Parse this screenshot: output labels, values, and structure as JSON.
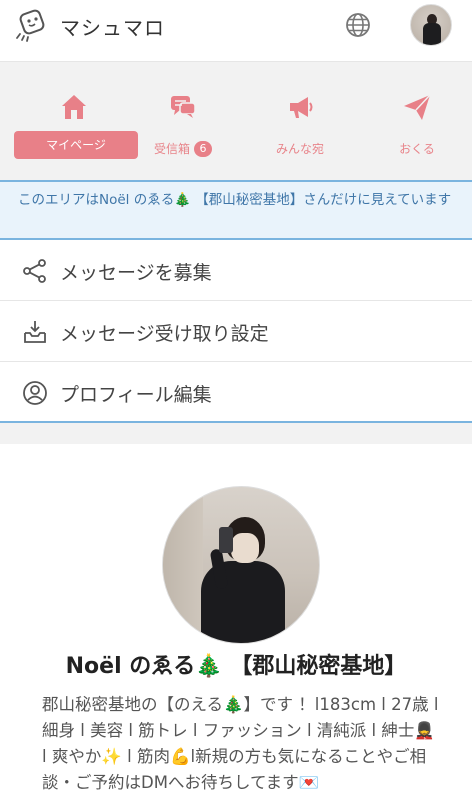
{
  "app": {
    "title": "マシュマロ"
  },
  "tabs": [
    {
      "label": "マイページ",
      "icon": "home-icon",
      "active": true
    },
    {
      "label": "受信箱",
      "badge": "6",
      "icon": "chat-bubbles-icon",
      "active": false
    },
    {
      "label": "みんな宛",
      "icon": "megaphone-icon",
      "active": false
    },
    {
      "label": "おくる",
      "icon": "paper-plane-icon",
      "active": false
    }
  ],
  "notice": {
    "text": "このエリアはNoël のゑる🎄 【郡山秘密基地】さんだけに見えています"
  },
  "menu": [
    {
      "label": "メッセージを募集",
      "icon": "share-icon"
    },
    {
      "label": "メッセージ受け取り設定",
      "icon": "inbox-download-icon"
    },
    {
      "label": "プロフィール編集",
      "icon": "profile-icon"
    }
  ],
  "profile": {
    "name": "Noël のゑる🎄 【郡山秘密基地】",
    "description": "郡山秘密基地の【のえる🎄】です ！l183cm l 27歳 l 細身 l 美容 l 筋トレ l ファッション l 清純派 l 紳士💂 l 爽やか✨ l 筋肉💪l新規の方も気になることやご相談・ご予約はDMへお待ちしてます💌"
  },
  "colors": {
    "accent": "#e88088",
    "notice_border": "#7ab4df",
    "notice_bg": "#e9f3fb"
  }
}
